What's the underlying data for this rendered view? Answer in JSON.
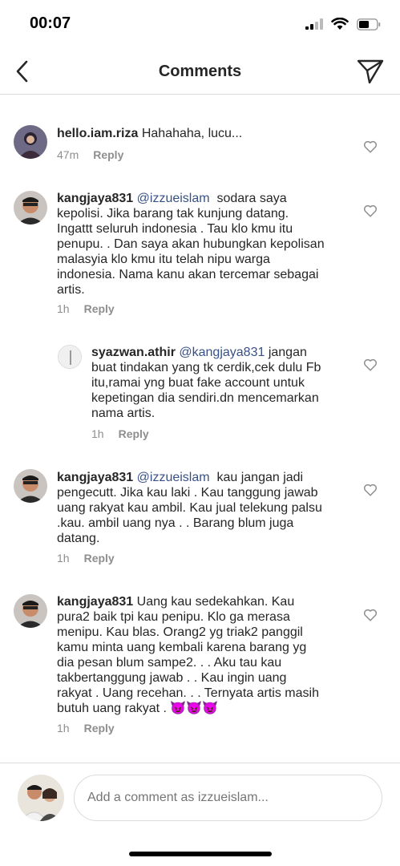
{
  "status": {
    "time": "00:07"
  },
  "header": {
    "title": "Comments"
  },
  "comments": [
    {
      "username": "hello.iam.riza",
      "mention": "",
      "text": "Hahahaha, lucu...",
      "time": "47m",
      "reply": "Reply"
    },
    {
      "username": "kangjaya831",
      "mention": "@izzueislam",
      "lines": [
        "sodara saya",
        "kepolisi.  Jika barang tak kunjung datang.",
        "Ingattt  seluruh  indonesia  . Tau klo kmu itu",
        "penupu. .  Dan saya akan hubungkan kepolisan",
        "malasyia klo kmu itu telah nipu warga",
        "indonesia.  Nama kanu akan tercemar sebagai",
        "artis."
      ],
      "time": "1h",
      "reply": "Reply"
    },
    {
      "username": "syazwan.athir",
      "mention": "@kangjaya831",
      "lines": [
        "jangan",
        "buat tindakan yang tk cerdik,cek dulu Fb",
        "itu,ramai yng buat fake account untuk",
        "kepetingan dia sendiri.dn mencemarkan",
        "nama artis."
      ],
      "time": "1h",
      "reply": "Reply"
    },
    {
      "username": "kangjaya831",
      "mention": "@izzueislam",
      "lines": [
        "kau jangan jadi",
        "pengecutt.  Jika kau laki . Kau tanggung jawab",
        "uang rakyat kau ambil.  Kau jual telekung palsu",
        ".kau.  ambil uang nya . .   Barang blum juga",
        "datang."
      ],
      "time": "1h",
      "reply": "Reply"
    },
    {
      "username": "kangjaya831",
      "mention": "",
      "lines": [
        "Uang kau sedekahkan.  Kau",
        "pura2 baik  tpi kau penipu.  Klo ga merasa",
        "menipu.  Kau blas.  Orang2 yg triak2 panggil",
        "kamu minta uang kembali karena barang  yg",
        "dia pesan blum sampe2. . .   Aku tau kau",
        "takbertanggung jawab . .   Kau ingin uang",
        "rakyat .  Uang recehan. . . Ternyata artis  masih",
        "butuh uang rakyat . 😈😈😈"
      ],
      "time": "1h",
      "reply": "Reply"
    }
  ],
  "composer": {
    "placeholder": "Add a comment as izzueislam..."
  },
  "colors": {
    "mention": "#385185",
    "muted": "#8e8e8e",
    "text": "#262626",
    "border": "#dbdbdb"
  }
}
